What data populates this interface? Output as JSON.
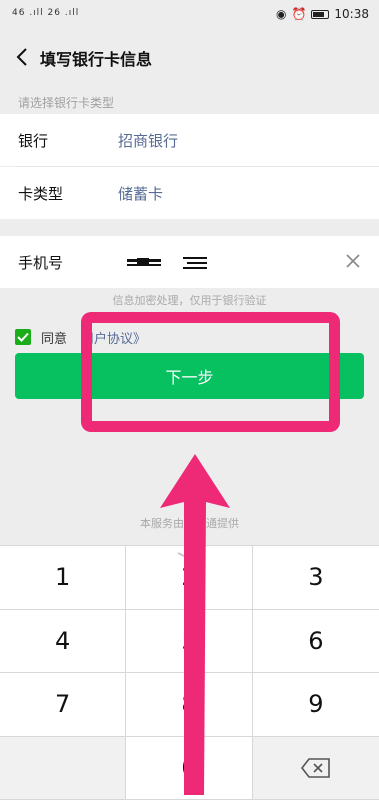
{
  "status_bar": {
    "signal_left": "46 .ıll 26 .ıll",
    "time": "10:38"
  },
  "header": {
    "title": "填写银行卡信息"
  },
  "card_type_section": {
    "label": "请选择银行卡类型",
    "rows": [
      {
        "label": "银行",
        "value": "招商银行"
      },
      {
        "label": "卡类型",
        "value": "储蓄卡"
      }
    ]
  },
  "phone": {
    "label": "手机号"
  },
  "hint": "信息加密处理，仅用于银行验证",
  "agreement": {
    "agree_label": "同意",
    "link": "用户协议》"
  },
  "next_button": {
    "label": "下一步"
  },
  "provider_note": "本服务由财付通提供",
  "keypad": {
    "keys": [
      "1",
      "2",
      "3",
      "4",
      "5",
      "6",
      "7",
      "8",
      "9",
      "",
      "0",
      ""
    ]
  },
  "colors": {
    "primary_green": "#07c160",
    "link_blue": "#576b95",
    "annotation_pink": "#ee2a77"
  }
}
